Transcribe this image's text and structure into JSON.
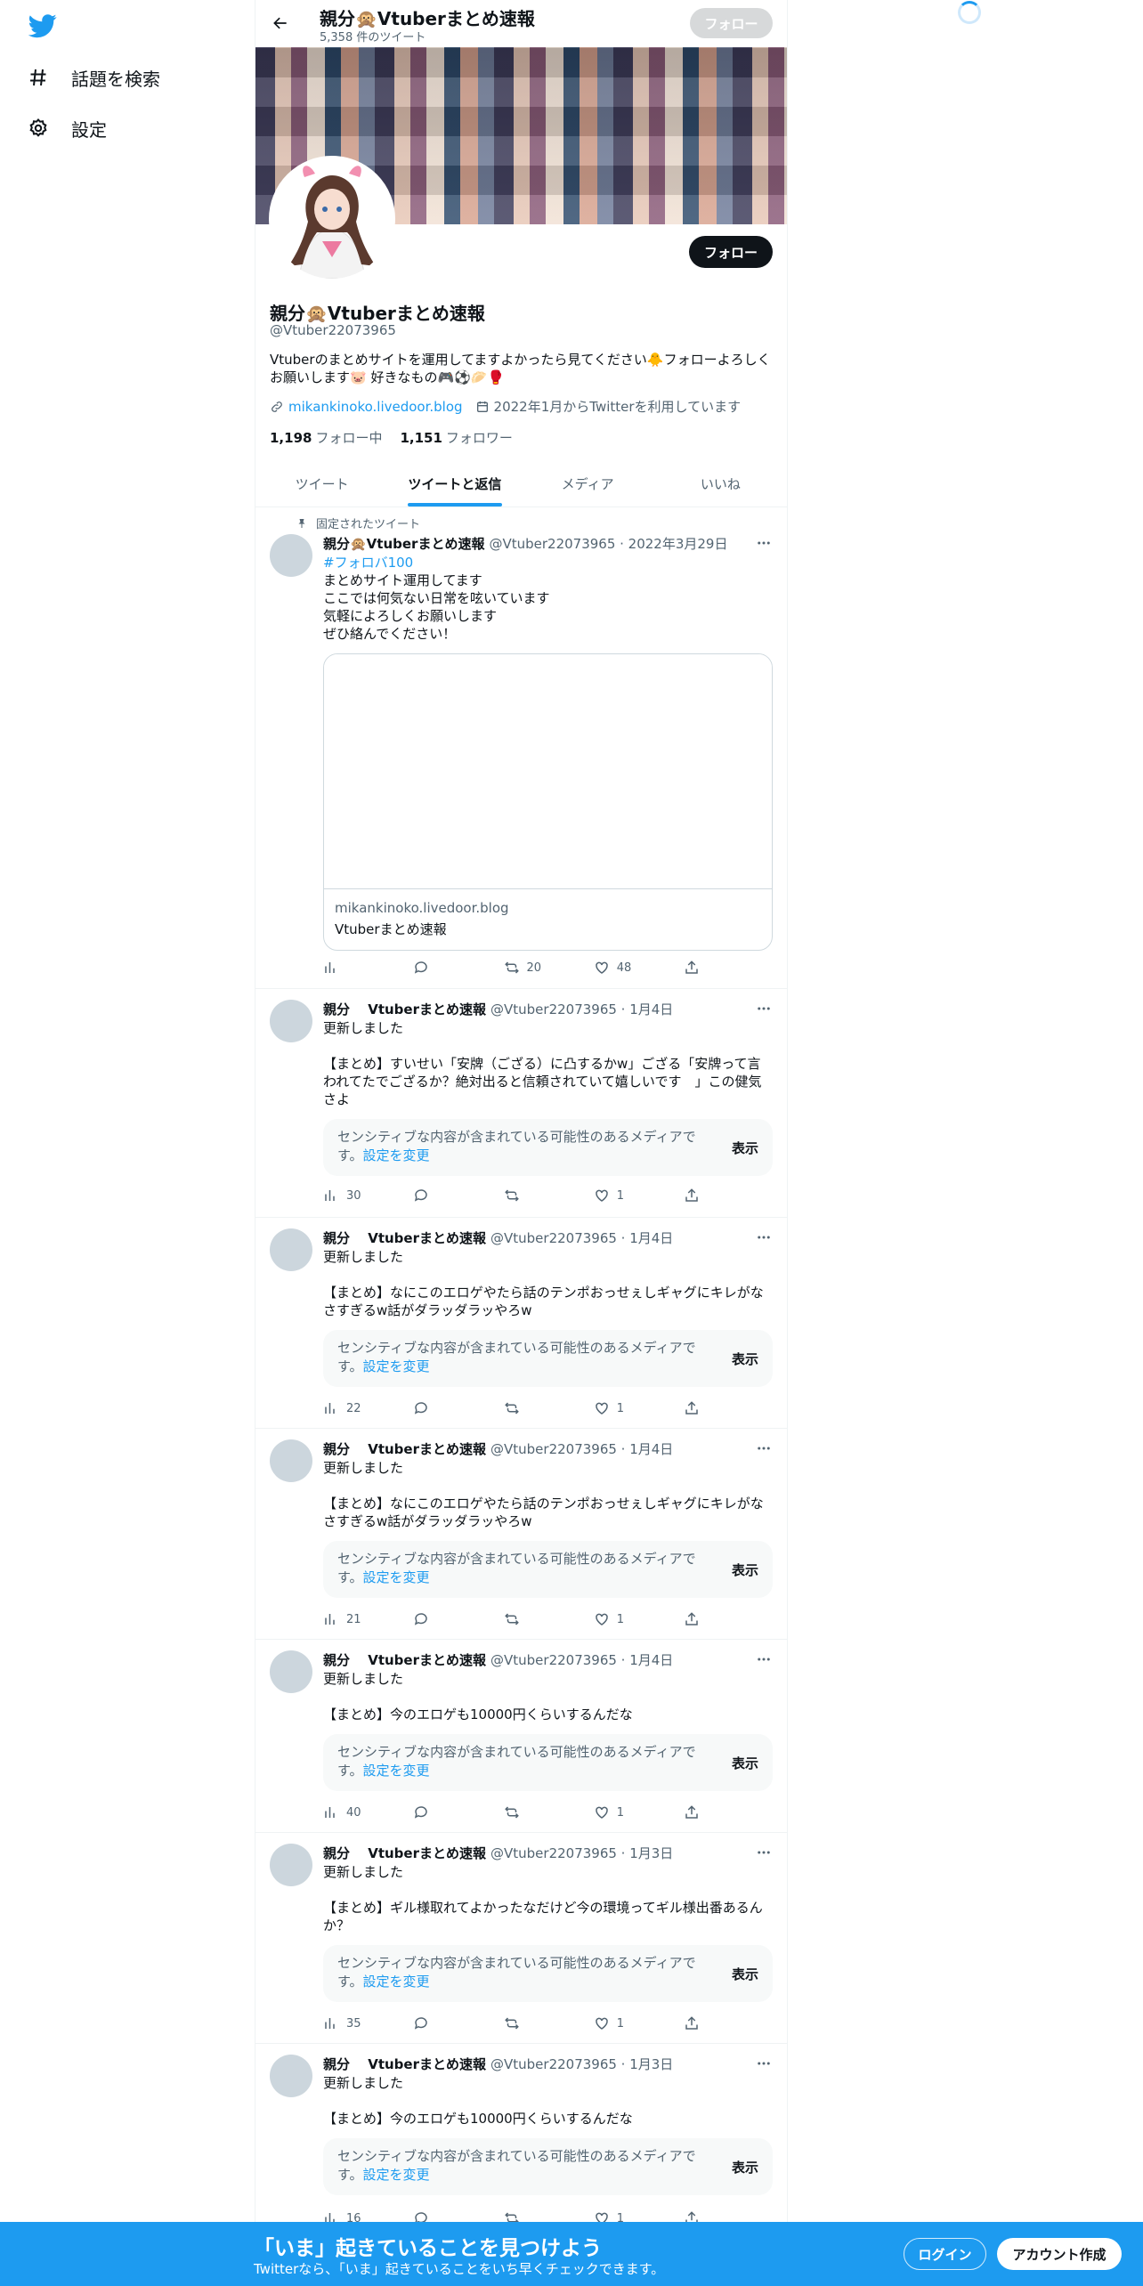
{
  "nav": {
    "logo": "twitter-bird-icon",
    "items": [
      {
        "label": "話題を検索",
        "icon": "hashtag-icon"
      },
      {
        "label": "設定",
        "icon": "gear-icon"
      }
    ]
  },
  "header": {
    "title": "親分🙊Vtuberまとめ速報",
    "tweet_count": "5,358 件のツイート",
    "follow_label": "フォロー"
  },
  "profile": {
    "name": "親分🙊Vtuberまとめ速報",
    "handle": "@Vtuber22073965",
    "bio": "Vtuberのまとめサイトを運用してますよかったら見てください🐥フォローよろしくお願いします🐷 好きなもの🎮⚽🥟🥊",
    "link": "mikankinoko.livedoor.blog",
    "joined": "2022年1月からTwitterを利用しています",
    "following_count": "1,198",
    "following_label": "フォロー中",
    "followers_count": "1,151",
    "followers_label": "フォロワー",
    "follow_label": "フォロー"
  },
  "tabs": [
    {
      "label": "ツイート"
    },
    {
      "label": "ツイートと返信"
    },
    {
      "label": "メディア"
    },
    {
      "label": "いいね"
    }
  ],
  "sensitive": {
    "text": "センシティブな内容が含まれている可能性のあるメディアです。",
    "link": "設定を変更",
    "show": "表示"
  },
  "tweets": [
    {
      "pinned_label": "固定されたツイート",
      "name": "親分🙊Vtuberまとめ速報",
      "handle": "@Vtuber22073965 · 2022年3月29日",
      "hashtag": "#フォロバ100",
      "text": "まとめサイト運用してます\nここでは何気ない日常を呟いています\n気軽によろしくお願いします\nぜひ絡んでください！",
      "card_domain": "mikankinoko.livedoor.blog",
      "card_title": "Vtuberまとめ速報",
      "views": "",
      "replies": "",
      "retweets": "20",
      "likes": "48"
    },
    {
      "name": "親分　 Vtuberまとめ速報",
      "handle": "@Vtuber22073965 · 1月4日",
      "text": "更新しました\n\n【まとめ】すいせい「安牌（ござる）に凸するかw」ござる「安牌って言われてたでござるか？絶対出ると信頼されていて嬉しいです　」この健気さよ",
      "views": "30",
      "replies": "",
      "retweets": "",
      "likes": "1"
    },
    {
      "name": "親分　 Vtuberまとめ速報",
      "handle": "@Vtuber22073965 · 1月4日",
      "text": "更新しました\n\n【まとめ】なにこのエロゲやたら話のテンポおっせぇしギャグにキレがなさすぎるw話がダラッダラッやろw",
      "views": "22",
      "replies": "",
      "retweets": "",
      "likes": "1"
    },
    {
      "name": "親分　 Vtuberまとめ速報",
      "handle": "@Vtuber22073965 · 1月4日",
      "text": "更新しました\n\n【まとめ】なにこのエロゲやたら話のテンポおっせぇしギャグにキレがなさすぎるw話がダラッダラッやろw",
      "views": "21",
      "replies": "",
      "retweets": "",
      "likes": "1"
    },
    {
      "name": "親分　 Vtuberまとめ速報",
      "handle": "@Vtuber22073965 · 1月4日",
      "text": "更新しました\n\n【まとめ】今のエロゲも10000円くらいするんだな",
      "views": "40",
      "replies": "",
      "retweets": "",
      "likes": "1"
    },
    {
      "name": "親分　 Vtuberまとめ速報",
      "handle": "@Vtuber22073965 · 1月3日",
      "text": "更新しました\n\n【まとめ】ギル様取れてよかったなだけど今の環境ってギル様出番あるんか？",
      "views": "35",
      "replies": "",
      "retweets": "",
      "likes": "1"
    },
    {
      "name": "親分　 Vtuberまとめ速報",
      "handle": "@Vtuber22073965 · 1月3日",
      "text": "更新しました\n\n【まとめ】今のエロゲも10000円くらいするんだな",
      "views": "16",
      "replies": "",
      "retweets": "",
      "likes": "1"
    }
  ],
  "bottom": {
    "title": "「いま」起きていることを見つけよう",
    "subtitle": "Twitterなら、「いま」起きていることをいち早くチェックできます。",
    "login": "ログイン",
    "signup": "アカウント作成"
  },
  "colors": {
    "accent": "#1d9bf0",
    "text": "#0f1419",
    "muted": "#536471"
  }
}
